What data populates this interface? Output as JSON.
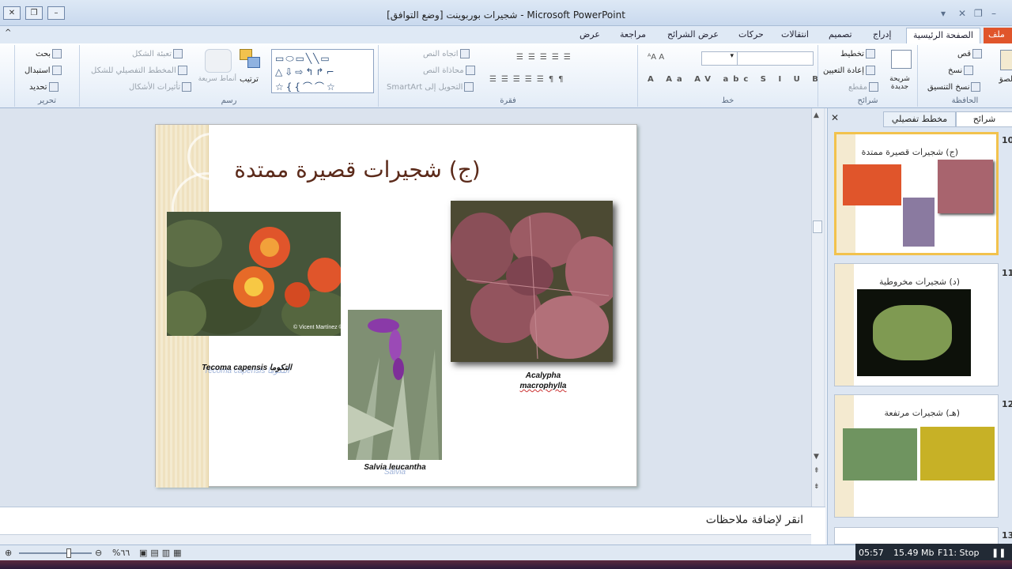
{
  "window": {
    "title": "شجيرات بوربوينت [وضع التوافق] - Microsoft PowerPoint"
  },
  "tabs": [
    "ملف",
    "الصفحة الرئيسية",
    "إدراج",
    "تصميم",
    "انتقالات",
    "حركات",
    "عرض الشرائح",
    "مراجعة",
    "عرض"
  ],
  "ribbon": {
    "clipboard": {
      "label": "الحافظة",
      "paste": "لصق",
      "cut": "قص",
      "copy": "نسخ",
      "format_painter": "نسخ التنسيق"
    },
    "slides": {
      "label": "شرائح",
      "new_slide": "شريحة جديدة",
      "layout": "تخطيط",
      "reset": "إعادة التعيين",
      "section": "مقطع"
    },
    "font": {
      "label": "خط"
    },
    "paragraph": {
      "label": "فقرة",
      "text_direction": "اتجاه النص",
      "align_text": "محاذاة النص",
      "smartart": "التحويل إلى SmartArt"
    },
    "drawing": {
      "label": "رسم",
      "arrange": "ترتيب",
      "quick_styles": "أنماط سريعة",
      "shape_fill": "تعبئة الشكل",
      "shape_outline": "المخطط التفصيلي للشكل",
      "shape_effects": "تأثيرات الأشكال"
    },
    "editing": {
      "label": "تحرير",
      "find": "بحث",
      "replace": "استبدال",
      "select": "تحديد"
    }
  },
  "slide": {
    "title": "(ج) شجيرات قصيرة ممتدة",
    "captions": {
      "lantana": "Tecoma capensis التكوما",
      "lantana_sub": "Tecoma capensis التكوما",
      "salvia": "Salvia leucantha",
      "salvia_sub": "Salvia",
      "acalypha1": "Acalypha",
      "acalypha2": "macrophylla"
    },
    "watermark": "© Vicent Martínez ©"
  },
  "notes": {
    "placeholder": "انقر لإضافة ملاحظات"
  },
  "panel": {
    "tab_slides": "شرائح",
    "tab_outline": "مخطط تفصيلي",
    "thumbs": [
      {
        "num": "10",
        "title": "(ج) شجيرات قصيرة ممتدة"
      },
      {
        "num": "11",
        "title": "(د) شجيرات مخروطية"
      },
      {
        "num": "12",
        "title": "(هـ) شجيرات مرتفعة"
      },
      {
        "num": "13",
        "title": ""
      }
    ]
  },
  "status": {
    "zoom": "%٦٦"
  },
  "overlay": {
    "time": "05:57",
    "size": "15.49 Mb",
    "stop": "F11: Stop"
  }
}
